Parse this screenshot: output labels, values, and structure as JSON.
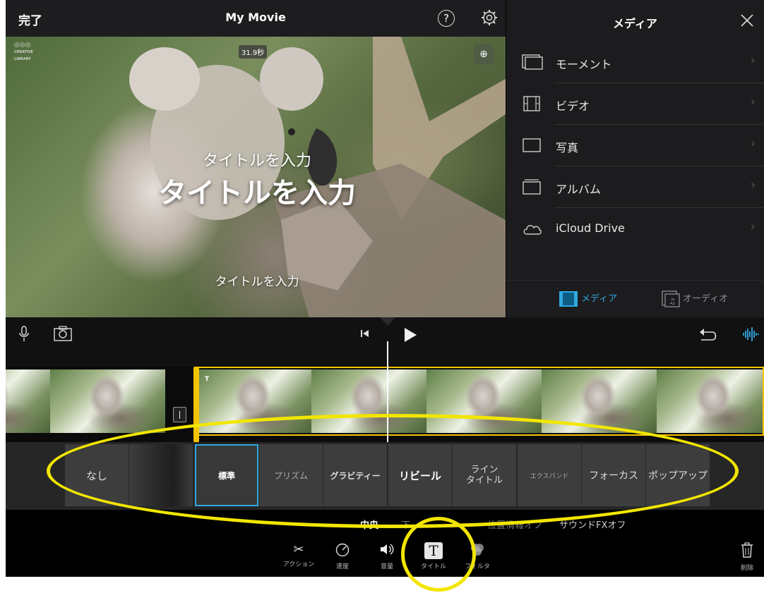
{
  "header": {
    "done_label": "完了",
    "title": "My Movie",
    "help_glyph": "?"
  },
  "viewer": {
    "logo_text": "CREATIVE LIBRARY",
    "duration": "31.9秒",
    "zoom_glyph": "⊕",
    "title_small": "タイトルを入力",
    "title_big": "タイトルを入力",
    "title_bottom": "タイトルを入力"
  },
  "media": {
    "title": "メディア",
    "items": [
      {
        "label": "モーメント",
        "icon": "moments-icon"
      },
      {
        "label": "ビデオ",
        "icon": "film-icon"
      },
      {
        "label": "写真",
        "icon": "photo-icon"
      },
      {
        "label": "アルバム",
        "icon": "album-icon"
      },
      {
        "label": "iCloud Drive",
        "icon": "cloud-icon"
      }
    ],
    "tabs": [
      {
        "label": "メディア",
        "active": true,
        "color": "#2fa8e0"
      },
      {
        "label": "オーディオ",
        "active": false,
        "color": "#8e8e93"
      }
    ]
  },
  "timeline": {
    "transition_glyph": "|",
    "title_marker": "T"
  },
  "title_styles": [
    {
      "label": "なし"
    },
    {
      "label": ""
    },
    {
      "label": "標準",
      "selected": true
    },
    {
      "label": "プリズム"
    },
    {
      "label": "グラビティー"
    },
    {
      "label": "リビール"
    },
    {
      "label": "ライン\nタイトル"
    },
    {
      "label": "エクスパンド"
    },
    {
      "label": "フォーカス"
    },
    {
      "label": "ポップアップ"
    }
  ],
  "options": {
    "center": "中央",
    "bottom": "下",
    "location": "位置情報オフ",
    "sound": "サウンドFXオフ"
  },
  "tools": [
    {
      "label": "アクション",
      "icon": "scissors-icon"
    },
    {
      "label": "速度",
      "icon": "speedometer-icon"
    },
    {
      "label": "音量",
      "icon": "speaker-icon"
    },
    {
      "label": "タイトル",
      "icon": "title-t-icon",
      "active": true
    },
    {
      "label": "フィルタ",
      "icon": "filter-icon"
    }
  ],
  "delete_label": "削除",
  "colors": {
    "accent": "#2fa8e0",
    "selection": "#f5c400",
    "annotation": "#f2e600"
  }
}
